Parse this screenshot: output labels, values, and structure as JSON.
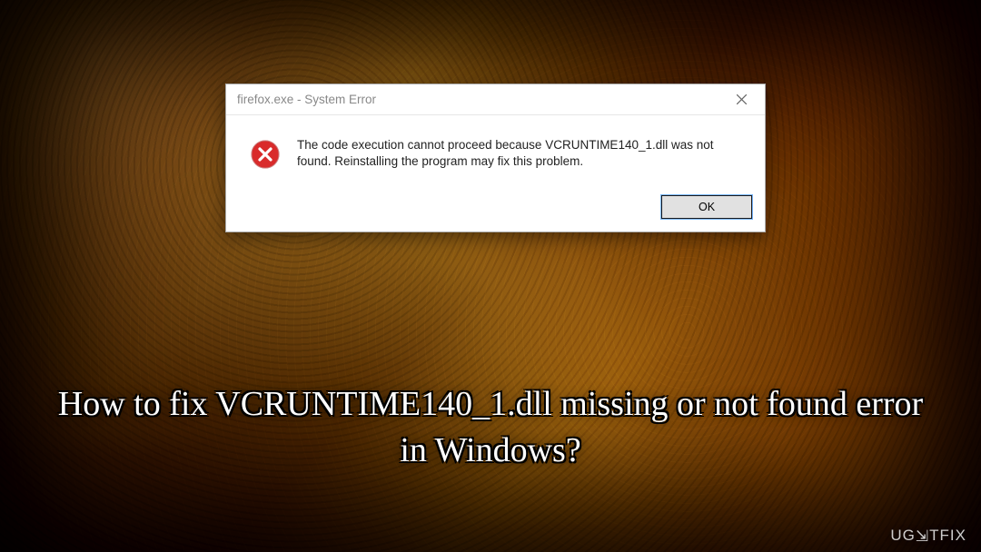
{
  "dialog": {
    "title": "firefox.exe - System Error",
    "message": "The code execution cannot proceed because VCRUNTIME140_1.dll was not found. Reinstalling the program may fix this problem.",
    "ok_label": "OK"
  },
  "caption": "How to fix VCRUNTIME140_1.dll missing or not found error in Windows?",
  "watermark": "UG⇲TFIX",
  "icons": {
    "close": "close-icon",
    "error": "error-icon"
  },
  "colors": {
    "dialog_bg": "#ffffff",
    "title_text": "#888888",
    "button_bg": "#e1e1e1",
    "error_red": "#d92b2b"
  }
}
